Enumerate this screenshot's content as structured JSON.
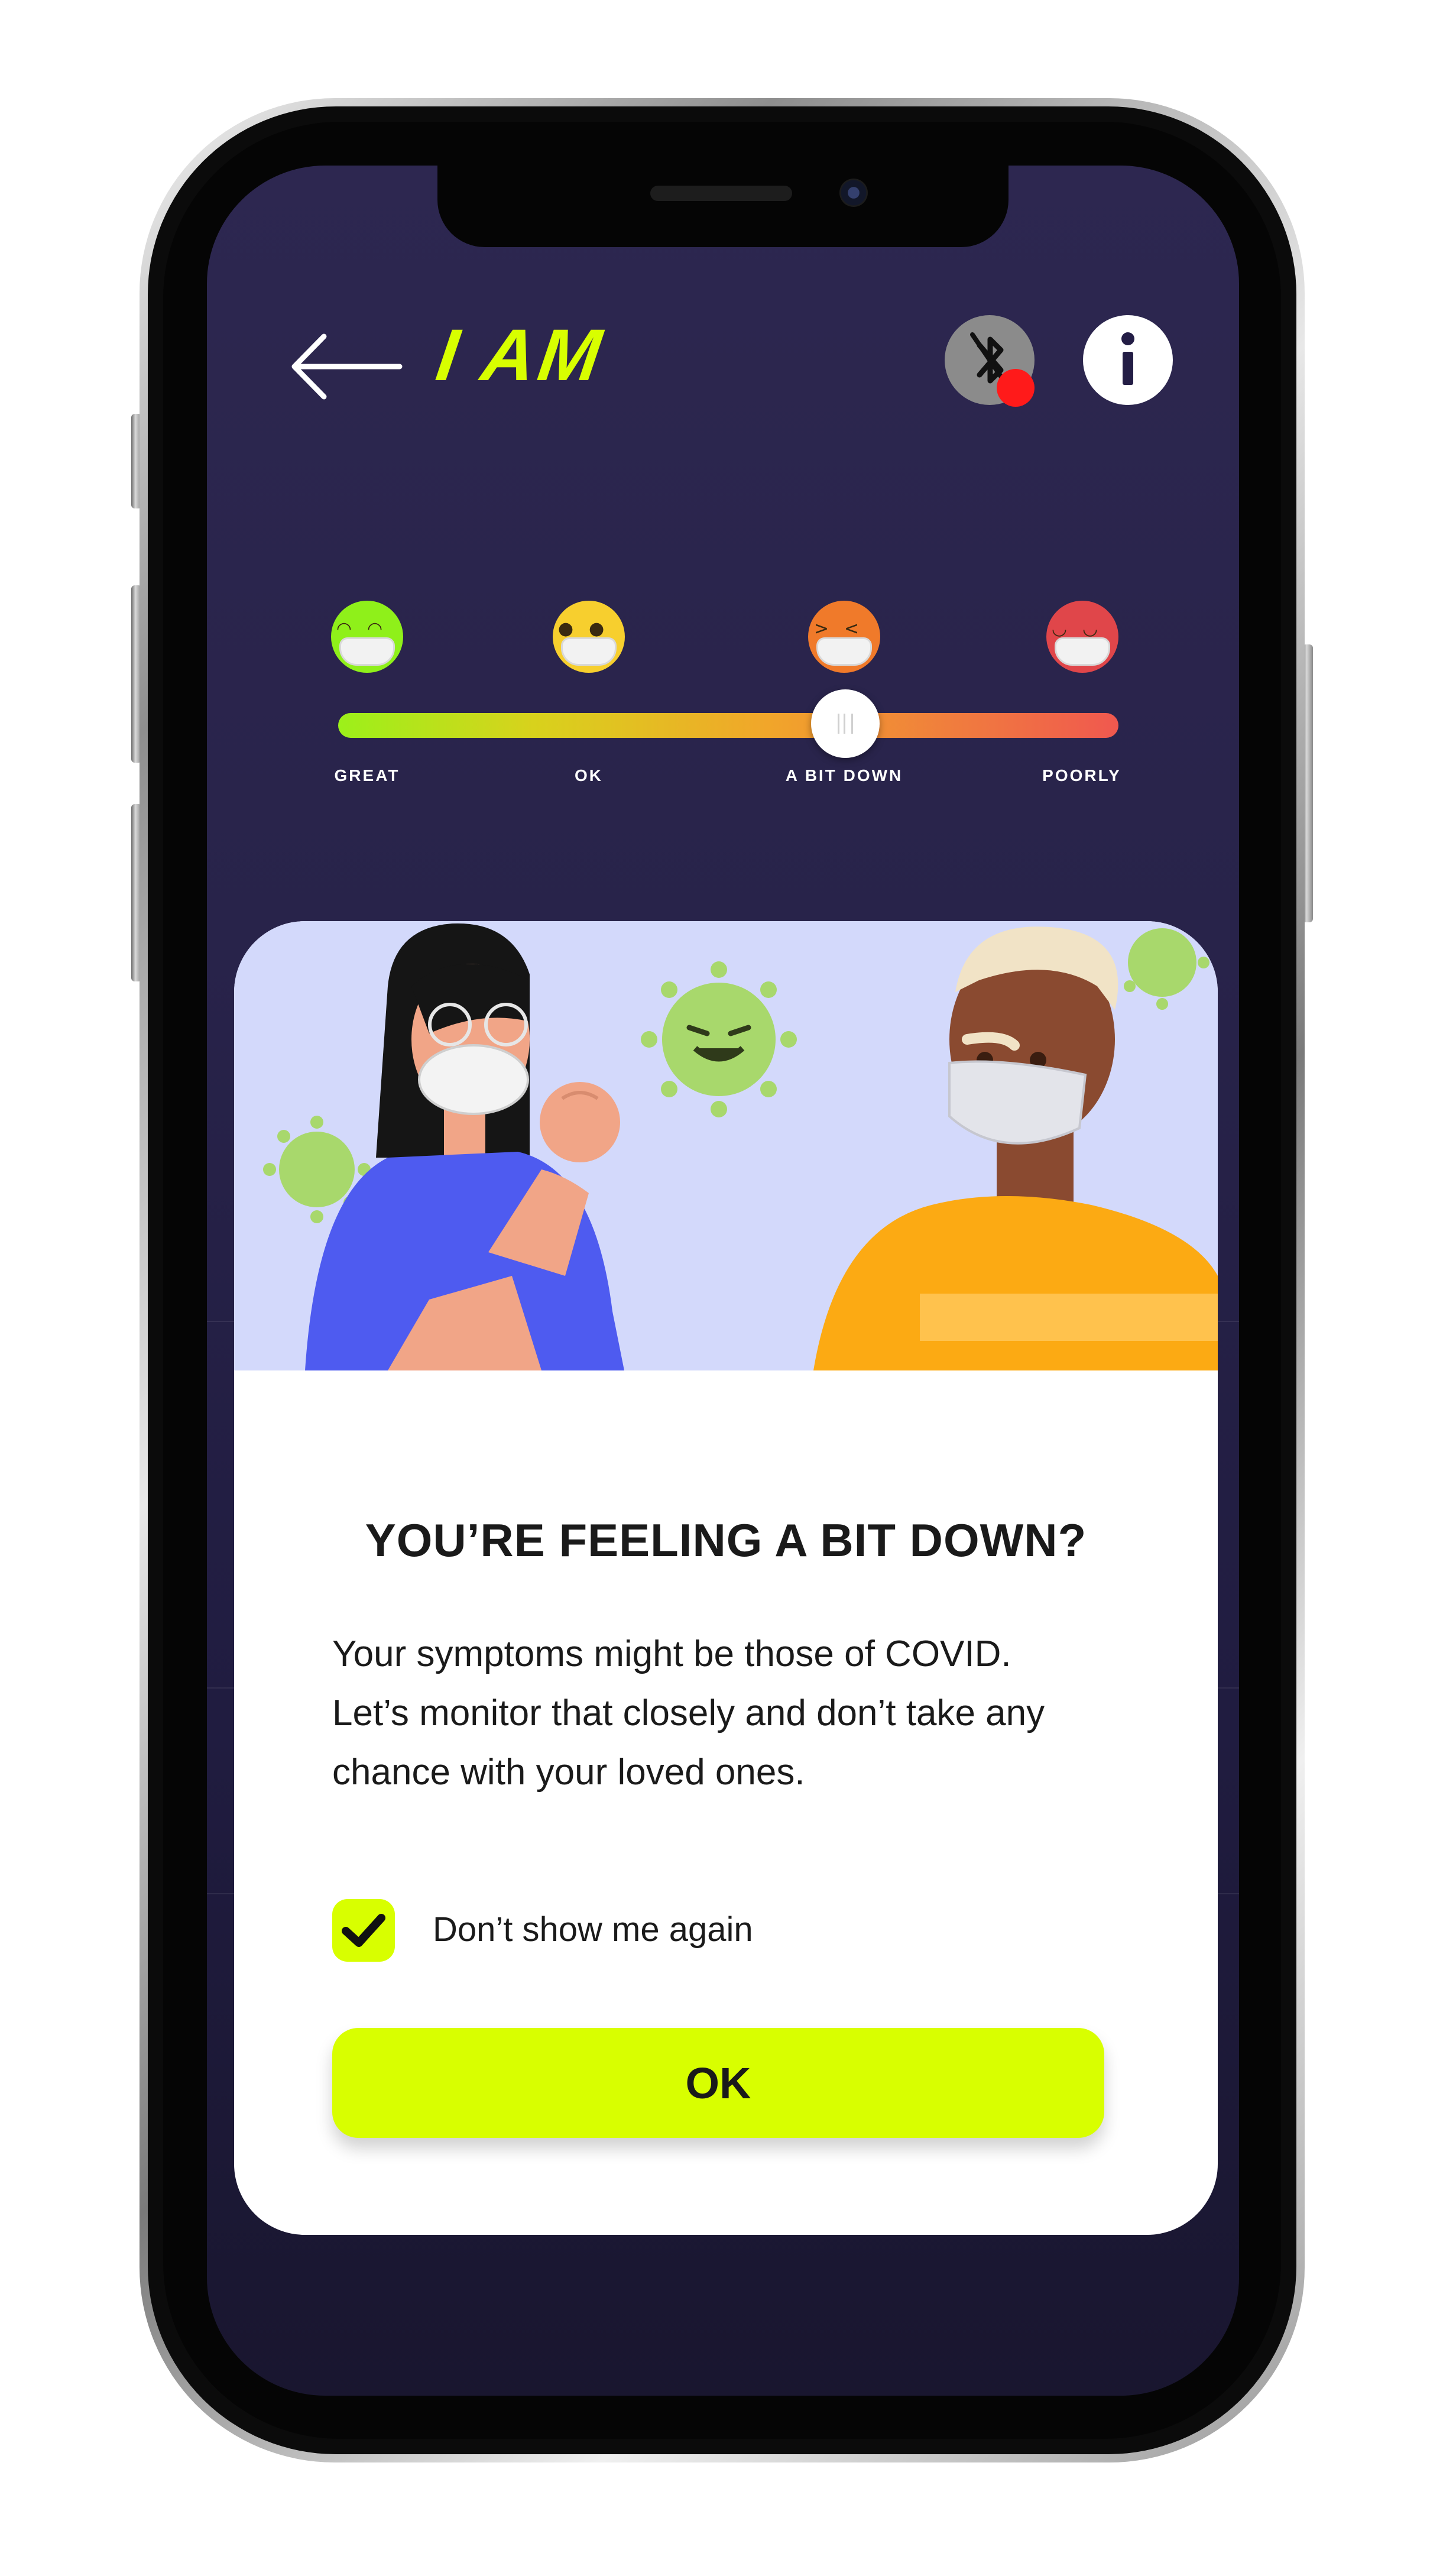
{
  "header": {
    "title": "I AM",
    "back_icon": "arrow-left-icon",
    "bluetooth_icon": "bluetooth-off-icon",
    "info_icon": "info-icon"
  },
  "mood_slider": {
    "options": [
      {
        "label": "GREAT",
        "icon": "masked-face-happy-icon",
        "color": "#8ff01a"
      },
      {
        "label": "OK",
        "icon": "masked-face-neutral-icon",
        "color": "#f7cf2e"
      },
      {
        "label": "A BIT DOWN",
        "icon": "masked-face-squint-icon",
        "color": "#f07a2a"
      },
      {
        "label": "POORLY",
        "icon": "masked-face-sick-icon",
        "color": "#e0464a"
      }
    ],
    "selected": "A BIT DOWN",
    "value_fraction": 0.65
  },
  "dialog": {
    "title": "YOU’RE FEELING A BIT DOWN?",
    "body_lines": [
      "Your symptoms might be those of COVID.",
      "Let’s monitor that closely and don’t take any",
      "chance with your loved ones."
    ],
    "checkbox_label": "Don’t show me again",
    "checkbox_checked": true,
    "ok_label": "OK"
  },
  "colors": {
    "accent": "#d8ff00",
    "screen_background": "#2b2550",
    "bluetooth_status": "#ff1a1a"
  }
}
